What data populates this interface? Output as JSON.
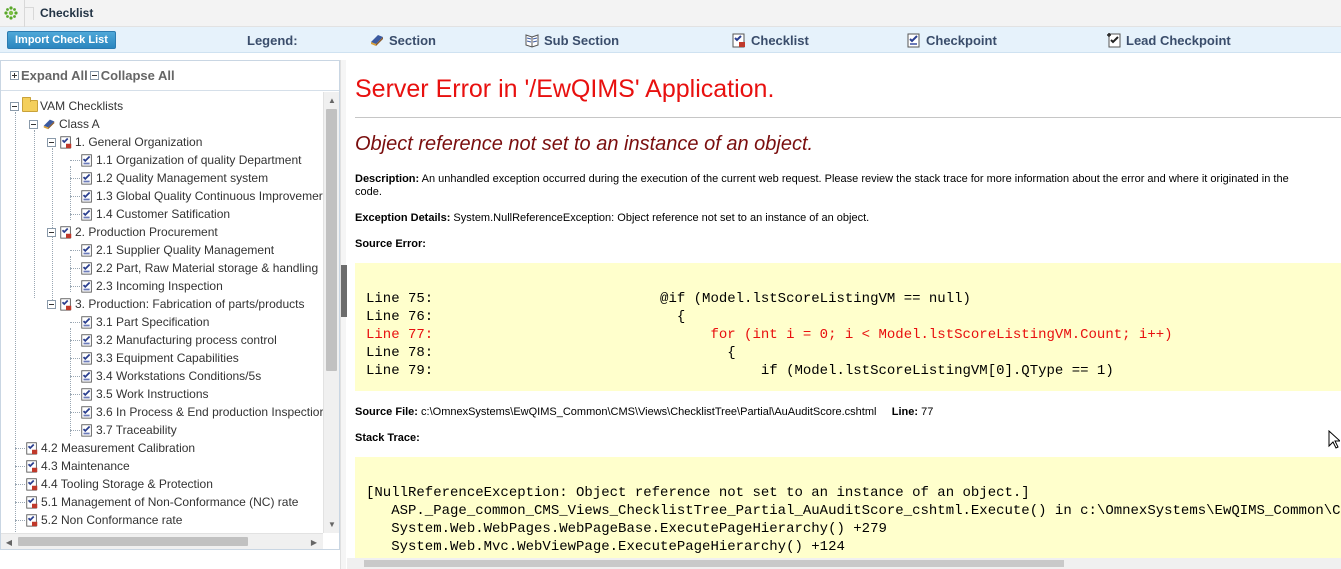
{
  "breadcrumb": {
    "title": "Checklist"
  },
  "toolbar": {
    "import_label": "Import Check List",
    "legend_label": "Legend:",
    "legend_items": [
      {
        "label": "Section",
        "icon": "section-icon"
      },
      {
        "label": "Sub Section",
        "icon": "sub-section-icon"
      },
      {
        "label": "Checklist",
        "icon": "checklist-icon"
      },
      {
        "label": "Checkpoint",
        "icon": "checkpoint-icon"
      },
      {
        "label": "Lead Checkpoint",
        "icon": "lead-checkpoint-icon"
      }
    ]
  },
  "tree": {
    "expand_all": "Expand All",
    "collapse_all": "Collapse All",
    "nodes": [
      {
        "label": "VAM Checklists"
      },
      {
        "label": "Class A"
      },
      {
        "label": "1. General Organization"
      },
      {
        "label": "1.1 Organization of quality Department"
      },
      {
        "label": "1.2 Quality Management system"
      },
      {
        "label": "1.3 Global Quality Continuous Improvemer"
      },
      {
        "label": "1.4 Customer Satification"
      },
      {
        "label": "2. Production Procurement"
      },
      {
        "label": "2.1 Supplier Quality Management"
      },
      {
        "label": "2.2 Part, Raw Material storage & handling"
      },
      {
        "label": "2.3 Incoming Inspection"
      },
      {
        "label": "3. Production: Fabrication of parts/products"
      },
      {
        "label": "3.1 Part Specification"
      },
      {
        "label": "3.2 Manufacturing process control"
      },
      {
        "label": "3.3 Equipment Capabilities"
      },
      {
        "label": "3.4 Workstations Conditions/5s"
      },
      {
        "label": "3.5 Work Instructions"
      },
      {
        "label": "3.6 In Process & End production Inspectior"
      },
      {
        "label": "3.7 Traceability"
      },
      {
        "label": "4.2 Measurement Calibration"
      },
      {
        "label": "4.3 Maintenance"
      },
      {
        "label": "4.4 Tooling Storage & Protection"
      },
      {
        "label": "5.1 Management of Non-Conformance (NC) rate"
      },
      {
        "label": "5.2 Non Conformance rate"
      }
    ]
  },
  "error": {
    "title": "Server Error in '/EwQIMS' Application.",
    "subtitle": "Object reference not set to an instance of an object.",
    "description_label": "Description:",
    "description_text": "An unhandled exception occurred during the execution of the current web request. Please review the stack trace for more information about the error and where it originated in the",
    "description_text2": "code.",
    "exception_label": "Exception Details:",
    "exception_text": "System.NullReferenceException: Object reference not set to an instance of an object.",
    "source_error_label": "Source Error:",
    "source_lines": [
      "Line 75:                           @if (Model.lstScoreListingVM == null)",
      "Line 76:                             {",
      "Line 77:                                 for (int i = 0; i < Model.lstScoreListingVM.Count; i++)",
      "Line 78:                                   {",
      "Line 79:                                       if (Model.lstScoreListingVM[0].QType == 1)"
    ],
    "source_file_label": "Source File:",
    "source_file_text": "c:\\OmnexSystems\\EwQIMS_Common\\CMS\\Views\\ChecklistTree\\Partial\\AuAuditScore.cshtml",
    "line_label": "Line:",
    "line_value": "77",
    "stack_trace_label": "Stack Trace:",
    "stack_lines": [
      "[NullReferenceException: Object reference not set to an instance of an object.]",
      "   ASP._Page_common_CMS_Views_ChecklistTree_Partial_AuAuditScore_cshtml.Execute() in c:\\OmnexSystems\\EwQIMS_Common\\CMS\\Vi",
      "   System.Web.WebPages.WebPageBase.ExecutePageHierarchy() +279",
      "   System.Web.Mvc.WebViewPage.ExecutePageHierarchy() +124"
    ]
  },
  "colors": {
    "error_red": "#e8100f",
    "subtitle_maroon": "#7a0e0e",
    "code_background": "#ffffcc",
    "toolbar_background": "#e6f2fb",
    "import_button": "#2b86bf"
  }
}
